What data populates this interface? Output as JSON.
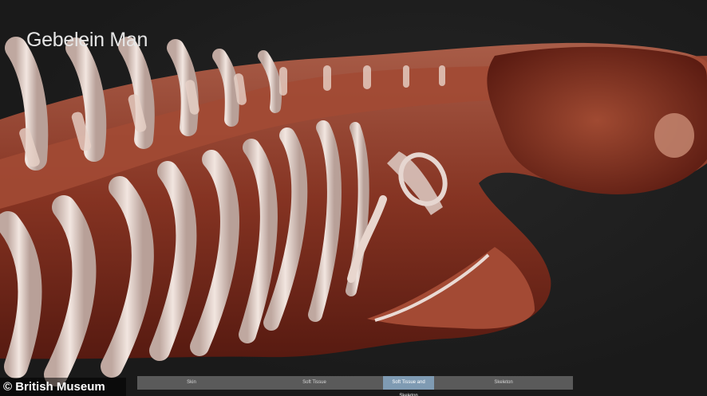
{
  "viewer": {
    "title": "Gebelein Man",
    "modes": [
      "Skin",
      "Soft Tissue",
      "Soft Tissue and Skeleton",
      "Skeleton"
    ],
    "active_mode": "Soft Tissue and Skeleton"
  },
  "credit": {
    "text": "© British Museum"
  },
  "colors": {
    "background": "#1c1c1c",
    "tissue": "#7a2a1c",
    "bone": "#e8d8d0",
    "active_mode": "#7f9bb3",
    "mode_bar": "#5a5a5a"
  }
}
